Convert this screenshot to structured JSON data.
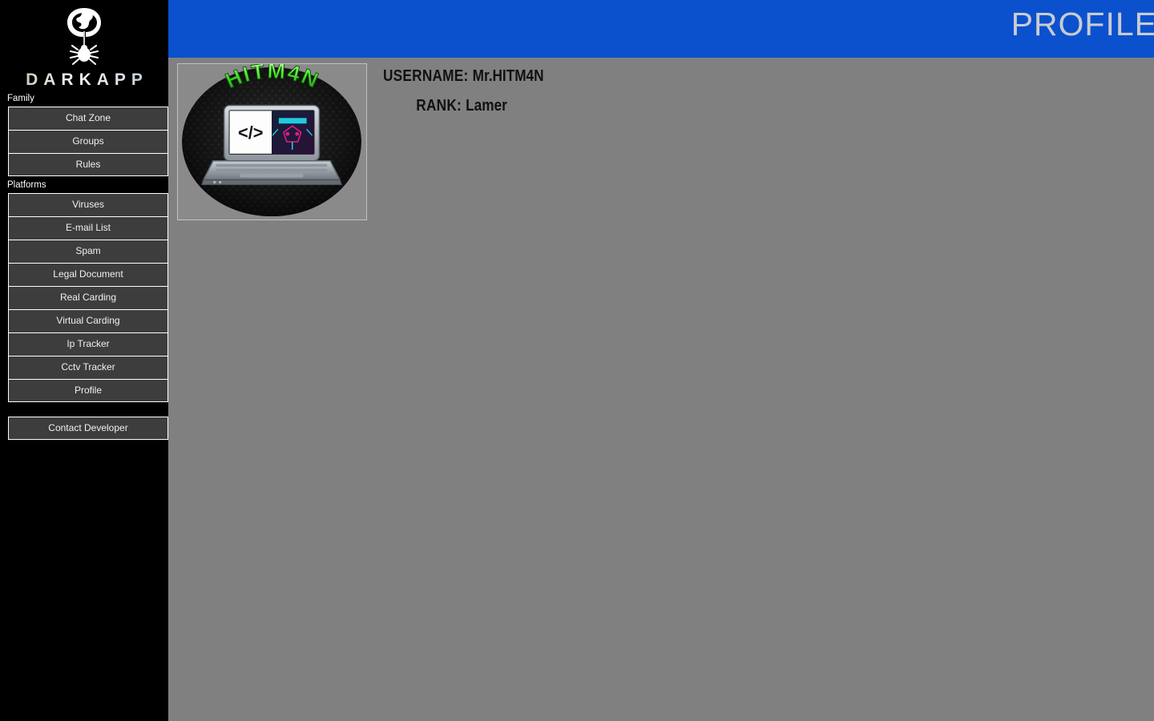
{
  "app": {
    "brand": "DARKAPP",
    "logo_icon": "globe-spider-icon"
  },
  "header": {
    "title": "PROFILE",
    "bg_color": "#0b51ce",
    "title_color": "#c9ccd1"
  },
  "sidebar": {
    "bg_color": "#000000",
    "button_color": "#3d3d3d",
    "sections": [
      {
        "label": "Family",
        "items": [
          {
            "label": "Chat Zone"
          },
          {
            "label": "Groups"
          },
          {
            "label": "Rules"
          }
        ]
      },
      {
        "label": "Platforms",
        "items": [
          {
            "label": "Viruses"
          },
          {
            "label": "E-mail List"
          },
          {
            "label": "Spam"
          },
          {
            "label": "Legal Document"
          },
          {
            "label": "Real Carding"
          },
          {
            "label": "Virtual Carding"
          },
          {
            "label": "Ip Tracker"
          },
          {
            "label": "Cctv Tracker"
          },
          {
            "label": "Profile"
          }
        ]
      }
    ],
    "contact": {
      "label": "Contact Developer"
    }
  },
  "profile": {
    "avatar": {
      "icon": "hitman-laptop-avatar",
      "banner_text": "HITM4N",
      "banner_color": "#3fd22a",
      "screen_code_glyph": "</>",
      "background": "dark-hex-mesh"
    },
    "fields": [
      {
        "key": "USERNAME:",
        "value": "Mr.HITM4N"
      },
      {
        "key": "RANK:",
        "value": "Lamer"
      }
    ]
  },
  "content": {
    "bg_color": "#808080"
  }
}
